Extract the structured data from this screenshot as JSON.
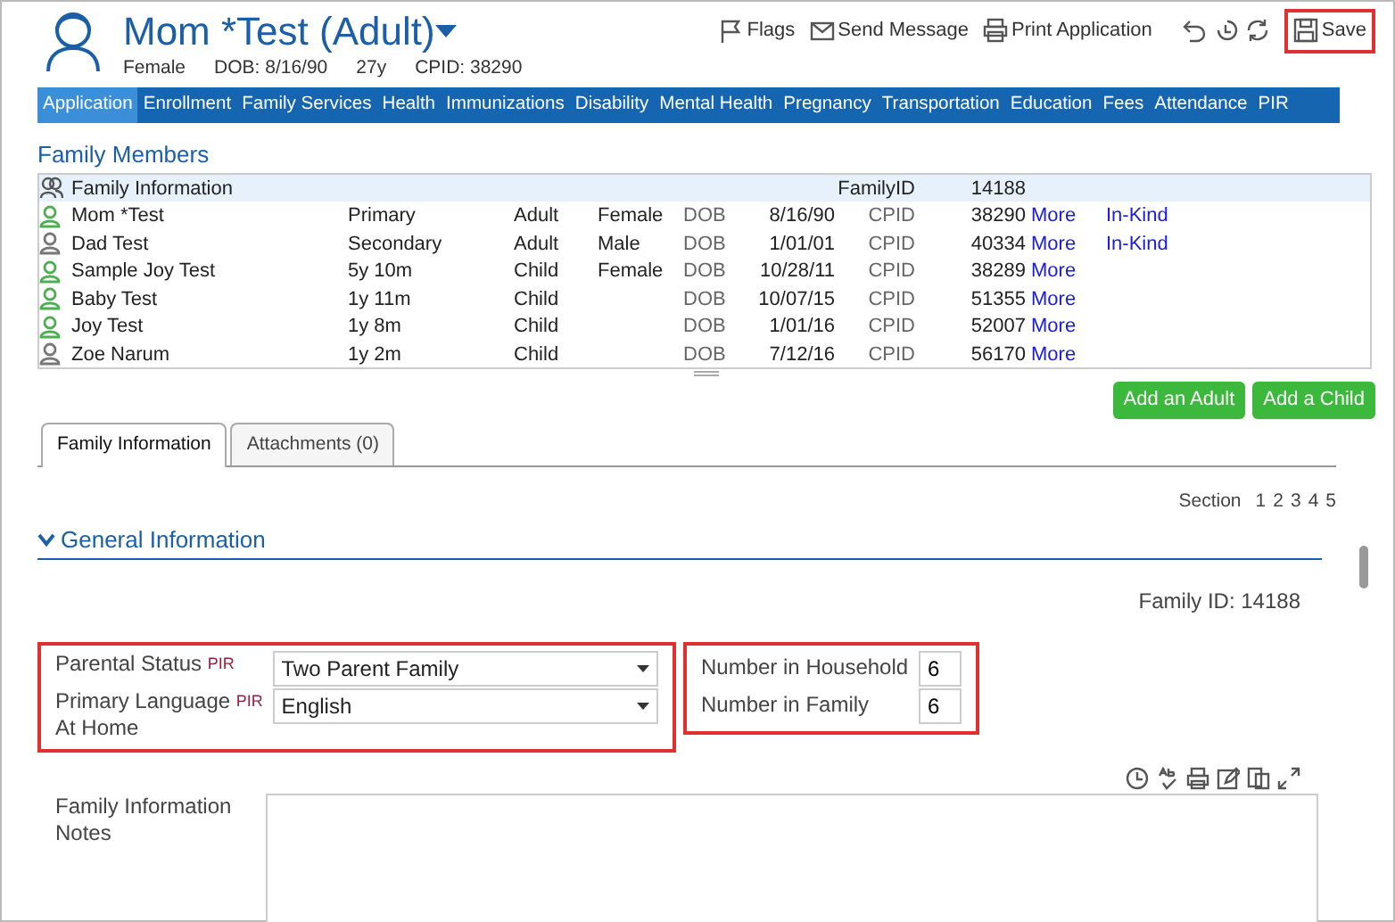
{
  "header": {
    "name": "Mom *Test (Adult)",
    "gender": "Female",
    "dob": "DOB: 8/16/90",
    "age": "27y",
    "cpid": "CPID: 38290"
  },
  "toolbar": [
    {
      "label": "Flags",
      "kind": "flag"
    },
    {
      "label": "Send Message",
      "kind": "mail"
    },
    {
      "label": "Print Application",
      "kind": "print"
    }
  ],
  "save": {
    "label": "Save",
    "highlighted": true
  },
  "nav_tabs": [
    {
      "label": "Application",
      "selected": true
    },
    {
      "label": "Enrollment",
      "selected": false
    },
    {
      "label": "Family Services",
      "selected": false
    },
    {
      "label": "Health",
      "selected": false
    },
    {
      "label": "Immunizations",
      "selected": false
    },
    {
      "label": "Disability",
      "selected": false
    },
    {
      "label": "Mental Health",
      "selected": false
    },
    {
      "label": "Pregnancy",
      "selected": false
    },
    {
      "label": "Transportation",
      "selected": false
    },
    {
      "label": "Education",
      "selected": false
    },
    {
      "label": "Fees",
      "selected": false
    },
    {
      "label": "Attendance",
      "selected": false
    },
    {
      "label": "PIR",
      "selected": false
    }
  ],
  "family_members": {
    "title": "Family Members",
    "summary": {
      "label": "Family Information",
      "id_label": "FamilyID",
      "id": "14188"
    },
    "members": [
      {
        "name": "Mom *Test",
        "relation": "Primary",
        "role": "Adult",
        "gender": "Female",
        "dob_label": "DOB",
        "dob": "8/16/90",
        "id_label": "CPID",
        "id": "38290",
        "links": [
          "More",
          "In-Kind"
        ],
        "color": "#4caf50"
      },
      {
        "name": "Dad Test",
        "relation": "Secondary",
        "role": "Adult",
        "gender": "Male",
        "dob_label": "DOB",
        "dob": "1/01/01",
        "id_label": "CPID",
        "id": "40334",
        "links": [
          "More",
          "In-Kind"
        ],
        "color": "#777777"
      },
      {
        "name": "Sample Joy Test",
        "relation": "5y 10m",
        "role": "Child",
        "gender": "Female",
        "dob_label": "DOB",
        "dob": "10/28/11",
        "id_label": "CPID",
        "id": "38289",
        "links": [
          "More"
        ],
        "color": "#4caf50"
      },
      {
        "name": "Baby Test",
        "relation": "1y 11m",
        "role": "Child",
        "dob_label": "DOB",
        "dob": "10/07/15",
        "id_label": "CPID",
        "id": "51355",
        "links": [
          "More"
        ],
        "color": "#4caf50"
      },
      {
        "name": "Joy Test",
        "relation": "1y 8m",
        "role": "Child",
        "dob_label": "DOB",
        "dob": "1/01/16",
        "id_label": "CPID",
        "id": "52007",
        "links": [
          "More"
        ],
        "color": "#4caf50"
      },
      {
        "name": "Zoe Narum",
        "relation": "1y 2m",
        "role": "Child",
        "dob_label": "DOB",
        "dob": "7/12/16",
        "id_label": "CPID",
        "id": "56170",
        "links": [
          "More"
        ],
        "color": "#777777"
      }
    ]
  },
  "buttons": [
    "Add an Adult",
    "Add a Child"
  ],
  "tabs": [
    {
      "label": "Family Information",
      "selected": true
    },
    {
      "label": "Attachments (0)",
      "selected": false
    }
  ],
  "section_nav": {
    "label": "Section",
    "pages": [
      "1",
      "2",
      "3",
      "4",
      "5"
    ]
  },
  "general": {
    "title": "General Information",
    "expanded": true,
    "family_id": "Family ID: 14188",
    "select_group": {
      "highlighted": true,
      "fields": [
        {
          "label_lines": [
            "Parental Status"
          ],
          "tag": "PIR",
          "value": "Two Parent Family"
        },
        {
          "label_lines": [
            "Primary Language",
            "At Home"
          ],
          "tag": "PIR",
          "value": "English"
        }
      ]
    },
    "count_group": {
      "highlighted": true,
      "fields": [
        {
          "label": "Number in Household",
          "value": "6"
        },
        {
          "label": "Number in Family",
          "value": "6"
        }
      ]
    },
    "notes": {
      "label": "Family Information Notes"
    }
  }
}
